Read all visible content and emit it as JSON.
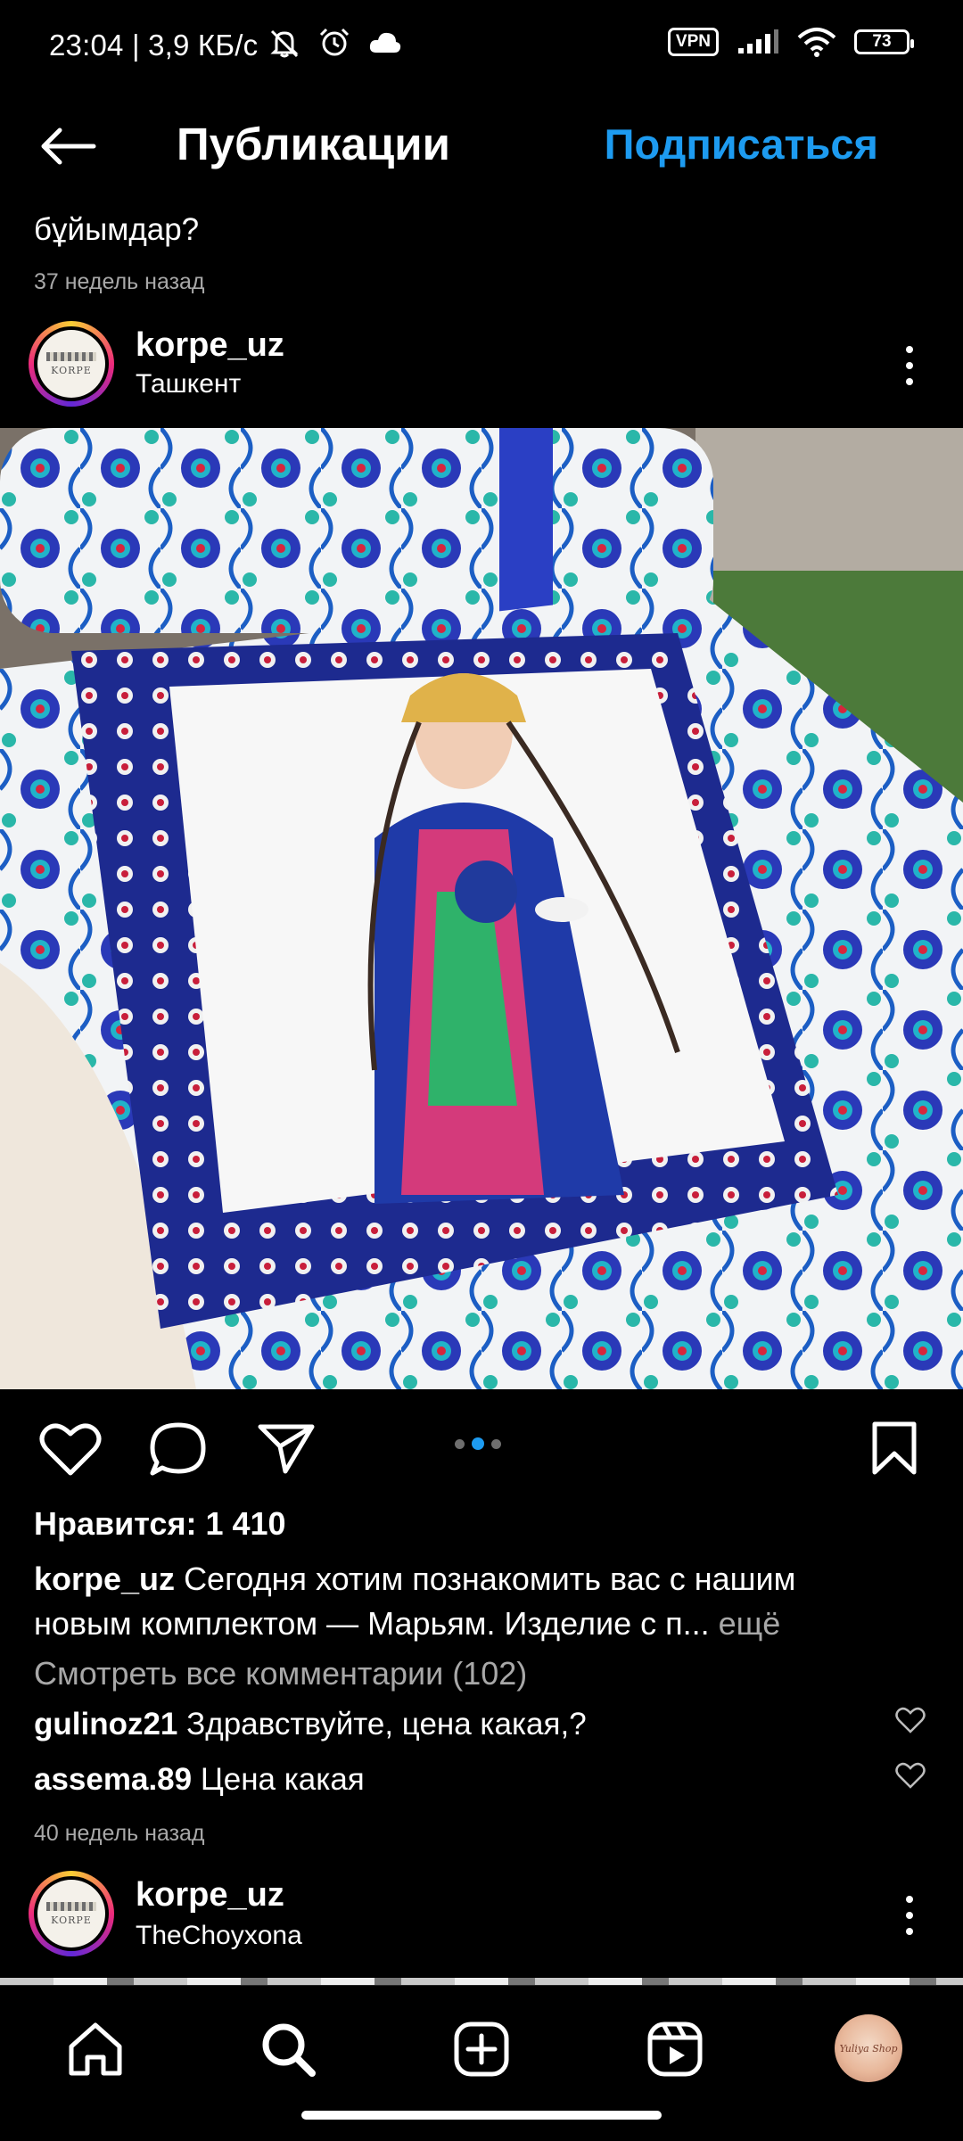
{
  "status_bar": {
    "time_speed": "23:04 | 3,9 КБ/с",
    "vpn": "VPN",
    "battery": "73"
  },
  "header": {
    "title": "Публикации",
    "follow": "Подписаться"
  },
  "previous_post": {
    "caption_tail": "бұйымдар?",
    "time": "37 недель назад"
  },
  "post": {
    "username": "korpe_uz",
    "location": "Ташкент",
    "avatar_text": "KORPE",
    "carousel": {
      "count": 3,
      "active": 1
    },
    "likes": "Нравится: 1 410",
    "caption_user": "korpe_uz",
    "caption_line1": "Сегодня хотим познакомить вас с нашим",
    "caption_line2": "новым комплектом — Марьям. Изделие с п...",
    "more": "ещё",
    "view_comments": "Смотреть все комментарии (102)",
    "comments": [
      {
        "user": "gulinoz21",
        "text": "Здравствуйте, цена какая,?"
      },
      {
        "user": "assema.89",
        "text": "Цена какая"
      }
    ],
    "time": "40 недель назад"
  },
  "next_post": {
    "username": "korpe_uz",
    "location": "TheChoyxona",
    "avatar_text": "KORPE"
  },
  "profile_pic_text": "Yuliya Shop",
  "colors": {
    "accent": "#1d9bf0",
    "secondary_text": "#a8a8a8",
    "background": "#000000"
  }
}
